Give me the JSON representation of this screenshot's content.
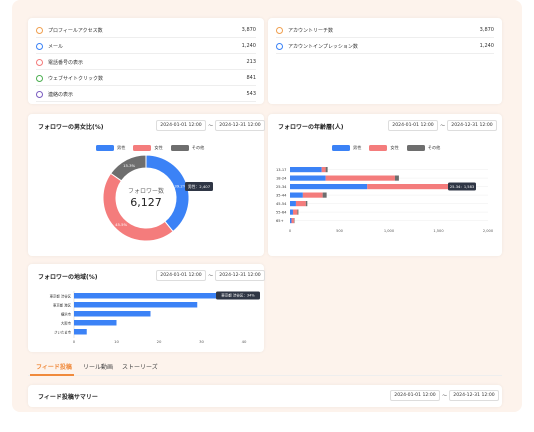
{
  "colors": {
    "male": "#3b82f6",
    "female": "#f47c7c",
    "other": "#6e6e6e",
    "accent": "#f08a3c"
  },
  "metrics_left": [
    {
      "label": "プロフィールアクセス数",
      "value": "3,870",
      "color": "#f0a050"
    },
    {
      "label": "メール",
      "value": "1,240",
      "color": "#3b82f6"
    },
    {
      "label": "電話番号の表示",
      "value": "213",
      "color": "#f47c7c"
    },
    {
      "label": "ウェブサイトクリック数",
      "value": "841",
      "color": "#4caf50"
    },
    {
      "label": "連絡の表示",
      "value": "543",
      "color": "#7a5cc0"
    }
  ],
  "metrics_right": [
    {
      "label": "アカウントリーチ数",
      "value": "3,870",
      "color": "#f0a050"
    },
    {
      "label": "アカウントインプレッション数",
      "value": "1,240",
      "color": "#3b82f6"
    }
  ],
  "gender": {
    "title": "フォロワーの男女比(%)",
    "date_from": "2024-01-01 12:00",
    "date_to": "2024-12-31 12:00",
    "tilde": "〜",
    "legend": [
      "男性",
      "女性",
      "その他"
    ],
    "center_label": "フォロワー数",
    "center_value": "6,127",
    "slice_labels": [
      "39.2%",
      "45.5%",
      "15.3%"
    ],
    "tooltip": "男性：2,407",
    "chart_data": {
      "type": "pie",
      "categories": [
        "男性",
        "女性",
        "その他"
      ],
      "values": [
        39.2,
        45.5,
        15.3
      ]
    }
  },
  "age": {
    "title": "フォロワーの年齢層(人)",
    "date_from": "2024-01-01 12:00",
    "date_to": "2024-12-31 12:00",
    "tilde": "〜",
    "legend": [
      "男性",
      "女性",
      "その他"
    ],
    "tooltip": "25-34：1,583",
    "chart_data": {
      "type": "bar",
      "orientation": "horizontal",
      "stacked": true,
      "categories": [
        "13-17",
        "18-24",
        "25-34",
        "35-44",
        "45-54",
        "55-64",
        "65+"
      ],
      "xlim": [
        0,
        2000
      ],
      "ticks": [
        "0",
        "500",
        "1,000",
        "1,500",
        "2,000"
      ],
      "series": [
        {
          "name": "男性",
          "values": [
            320,
            360,
            780,
            130,
            60,
            30,
            15
          ]
        },
        {
          "name": "女性",
          "values": [
            40,
            700,
            900,
            200,
            100,
            45,
            25
          ]
        },
        {
          "name": "その他",
          "values": [
            20,
            40,
            80,
            40,
            15,
            10,
            5
          ]
        }
      ]
    }
  },
  "region": {
    "title": "フォロワーの地域(%)",
    "date_from": "2024-01-01 12:00",
    "date_to": "2024-12-31 12:00",
    "tilde": "〜",
    "tooltip": "東京都 渋谷区：34%",
    "chart_data": {
      "type": "bar",
      "orientation": "horizontal",
      "categories": [
        "東京都 渋谷区",
        "東京都 港区",
        "横浜市",
        "大阪市",
        "さいたま市"
      ],
      "values": [
        34,
        29,
        18,
        10,
        3
      ],
      "xlim": [
        0,
        40
      ],
      "ticks": [
        "0",
        "10",
        "20",
        "30",
        "40"
      ]
    }
  },
  "tabs": [
    "フィード投稿",
    "リール動画",
    "ストーリーズ"
  ],
  "summary": {
    "title": "フィード投稿サマリー",
    "date_from": "2024-01-01 12:00",
    "date_to": "2024-12-31 12:00",
    "tilde": "〜"
  }
}
